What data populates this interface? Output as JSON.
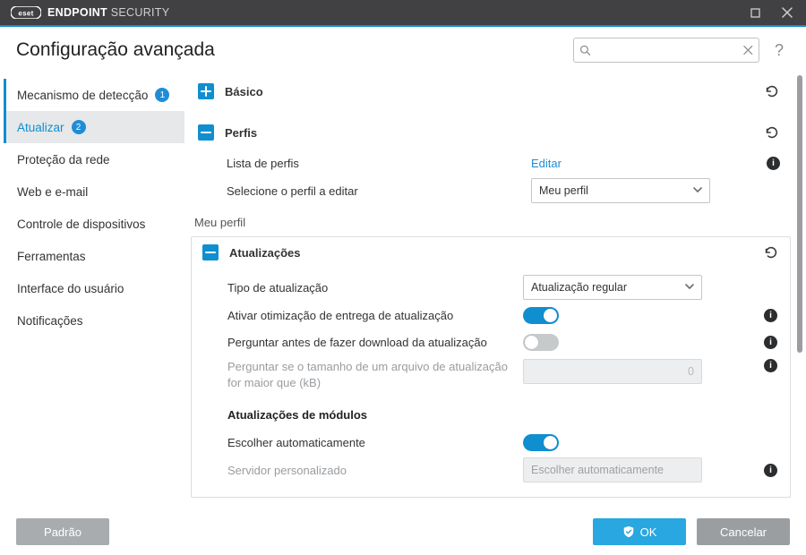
{
  "app": {
    "brand_prefix": "ENDPOINT",
    "brand_suffix": "SECURITY"
  },
  "header": {
    "title": "Configuração avançada",
    "help": "?"
  },
  "sidebar": {
    "items": [
      {
        "label": "Mecanismo de detecção",
        "badge": "1"
      },
      {
        "label": "Atualizar",
        "badge": "2"
      },
      {
        "label": "Proteção da rede"
      },
      {
        "label": "Web e e-mail"
      },
      {
        "label": "Controle de dispositivos"
      },
      {
        "label": "Ferramentas"
      },
      {
        "label": "Interface do usuário"
      },
      {
        "label": "Notificações"
      }
    ]
  },
  "content": {
    "basic": {
      "title": "Básico"
    },
    "profiles": {
      "title": "Perfis",
      "list_label": "Lista de perfis",
      "list_action": "Editar",
      "select_label": "Selecione o perfil a editar",
      "select_value": "Meu perfil"
    },
    "profile_name": "Meu perfil",
    "updates": {
      "title": "Atualizações",
      "type_label": "Tipo de atualização",
      "type_value": "Atualização regular",
      "opt_label": "Ativar otimização de entrega de atualização",
      "ask_label": "Perguntar antes de fazer download da atualização",
      "size_label": "Perguntar se o tamanho de um arquivo de atualização for maior que (kB)",
      "size_value": "0",
      "modules_heading": "Atualizações de módulos",
      "auto_label": "Escolher automaticamente",
      "server_label": "Servidor personalizado",
      "server_placeholder": "Escolher automaticamente"
    }
  },
  "footer": {
    "default": "Padrão",
    "ok": "OK",
    "cancel": "Cancelar"
  }
}
